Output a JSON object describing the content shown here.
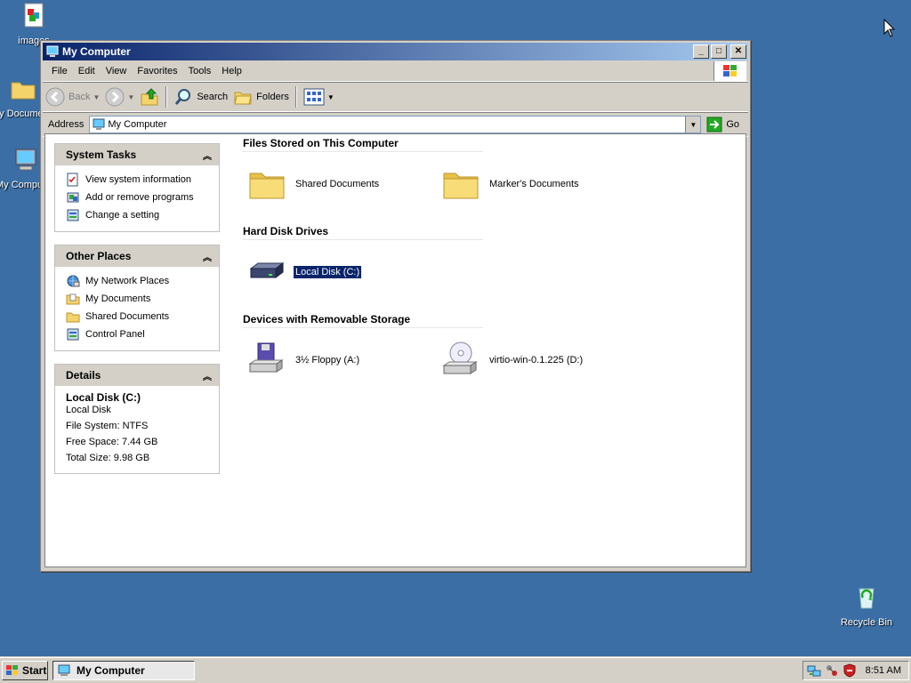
{
  "desktop": {
    "icons": [
      {
        "label": "images"
      },
      {
        "label": "My Documents"
      },
      {
        "label": "My Computer"
      },
      {
        "label": "Recycle Bin"
      }
    ]
  },
  "window": {
    "title": "My Computer",
    "menu": [
      "File",
      "Edit",
      "View",
      "Favorites",
      "Tools",
      "Help"
    ],
    "toolbar": {
      "back": "Back",
      "search": "Search",
      "folders": "Folders"
    },
    "address": {
      "label": "Address",
      "value": "My Computer",
      "go": "Go"
    }
  },
  "tasks": {
    "system": {
      "title": "System Tasks",
      "items": [
        "View system information",
        "Add or remove programs",
        "Change a setting"
      ]
    },
    "other": {
      "title": "Other Places",
      "items": [
        "My Network Places",
        "My Documents",
        "Shared Documents",
        "Control Panel"
      ]
    },
    "details": {
      "title": "Details",
      "name": "Local Disk (C:)",
      "type": "Local Disk",
      "filesystem": "File System: NTFS",
      "free": "Free Space: 7.44 GB",
      "total": "Total Size: 9.98 GB"
    }
  },
  "groups": {
    "files": {
      "title": "Files Stored on This Computer",
      "items": [
        "Shared Documents",
        "Marker's Documents"
      ]
    },
    "hdd": {
      "title": "Hard Disk Drives",
      "items": [
        "Local Disk (C:)"
      ]
    },
    "removable": {
      "title": "Devices with Removable Storage",
      "items": [
        "3½ Floppy (A:)",
        "virtio-win-0.1.225 (D:)"
      ]
    }
  },
  "taskbar": {
    "start": "Start",
    "task": "My Computer",
    "clock": "8:51 AM"
  },
  "colors": {
    "desktop": "#3a6ea5",
    "titlebar_start": "#0a246a",
    "titlebar_end": "#a6caf0",
    "selection": "#0a246a"
  }
}
